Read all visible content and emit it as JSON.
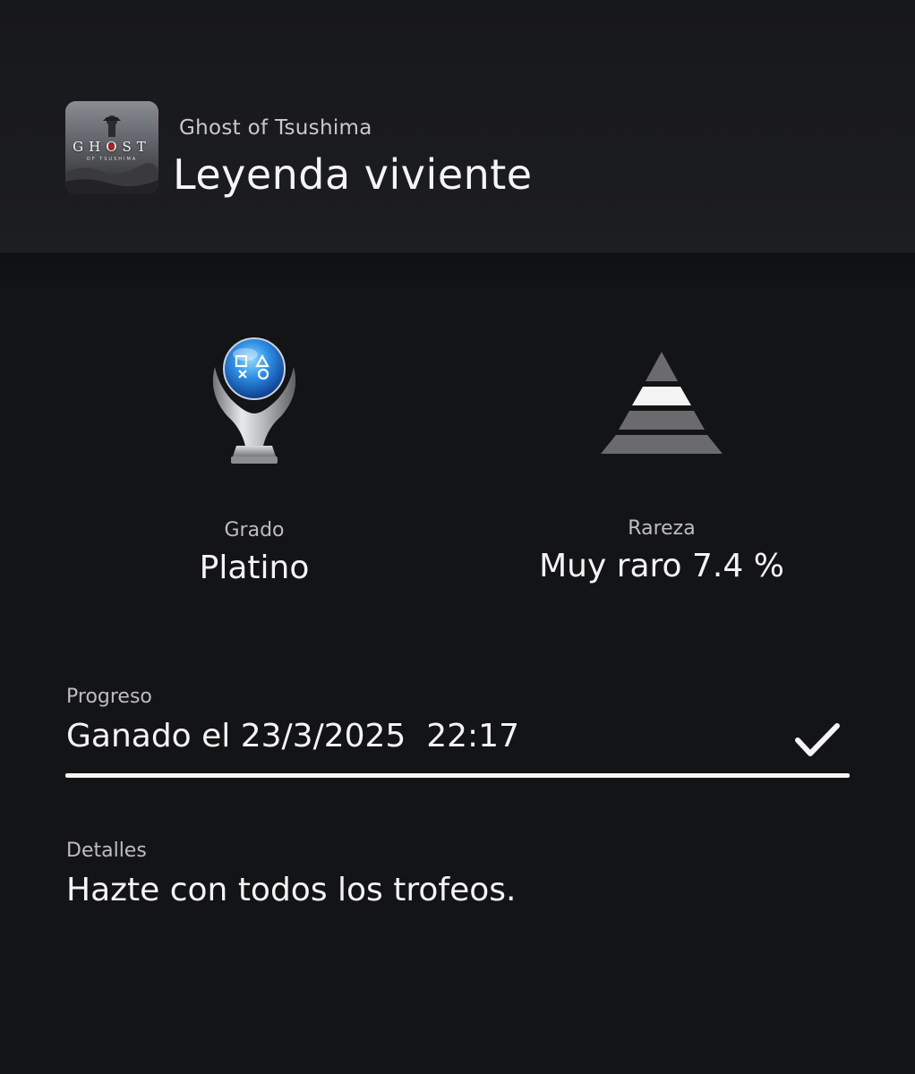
{
  "header": {
    "game_title": "Ghost of Tsushima",
    "trophy_name": "Leyenda viviente",
    "thumbnail": {
      "title": "GHOST",
      "subtitle": "OF TSUSHIMA"
    }
  },
  "stats": {
    "grade": {
      "label": "Grado",
      "value": "Platino",
      "icon": "platinum-trophy-icon"
    },
    "rarity": {
      "label": "Rareza",
      "value": "Muy raro 7.4 %",
      "icon": "rarity-pyramid-icon"
    }
  },
  "progress": {
    "label": "Progreso",
    "value": "Ganado el 23/3/2025  22:17",
    "fraction": 1.0,
    "icon": "checkmark-icon"
  },
  "details": {
    "label": "Detalles",
    "value": "Hazte con todos los trofeos."
  },
  "colors": {
    "background": "#131416",
    "header_background": "#1a1b1e",
    "primary_text": "#f4f4f4",
    "secondary_text": "#bdbdc0",
    "progress_fill": "#f5f5f5",
    "trophy_blue": "#2f8fe6"
  }
}
